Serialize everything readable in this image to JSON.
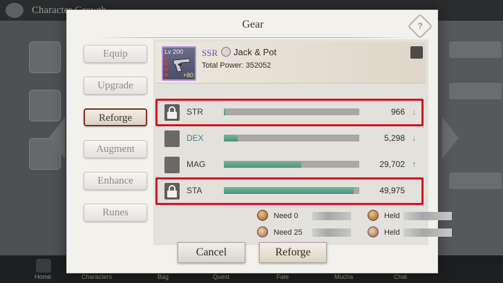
{
  "background": {
    "title": "Character Growth",
    "nav": [
      "Home",
      "Characters",
      "Bag",
      "Quest",
      "Fate",
      "Mucha",
      "Chat"
    ]
  },
  "dialog": {
    "title": "Gear",
    "help_label": "?"
  },
  "tabs": [
    {
      "label": "Equip",
      "active": false
    },
    {
      "label": "Upgrade",
      "active": false
    },
    {
      "label": "Reforge",
      "active": true
    },
    {
      "label": "Augment",
      "active": false
    },
    {
      "label": "Enhance",
      "active": false
    },
    {
      "label": "Runes",
      "active": false
    }
  ],
  "item": {
    "level": "Lv 200",
    "enhance": "+80",
    "rarity": "SSR",
    "name": "Jack & Pot",
    "total_power": "Total Power: 352052",
    "rarity_color": "#6f49b7"
  },
  "stats": [
    {
      "label": "STR",
      "value": "966",
      "fill": 0.01,
      "locked": true,
      "trend": "down",
      "highlighted": true
    },
    {
      "label": "DEX",
      "value": "5,298",
      "fill": 0.1,
      "locked": false,
      "trend": "down",
      "highlighted": false
    },
    {
      "label": "MAG",
      "value": "29,702",
      "fill": 0.57,
      "locked": false,
      "trend": "up",
      "highlighted": false
    },
    {
      "label": "STA",
      "value": "49,975",
      "fill": 0.96,
      "locked": true,
      "trend": "up-hidden",
      "highlighted": true
    }
  ],
  "costs": [
    {
      "icon": "coin-icon",
      "need": "Need 0",
      "held": "Held"
    },
    {
      "icon": "shell-icon",
      "need": "Need 25",
      "held": "Held"
    }
  ],
  "buttons": {
    "cancel": "Cancel",
    "reforge": "Reforge"
  },
  "colors": {
    "highlight": "#d6121a",
    "bar_fill": "#5a9c84",
    "trend_down": "#d9797b",
    "trend_up": "#4f9a73",
    "active_tab_border": "#7a2e26"
  }
}
